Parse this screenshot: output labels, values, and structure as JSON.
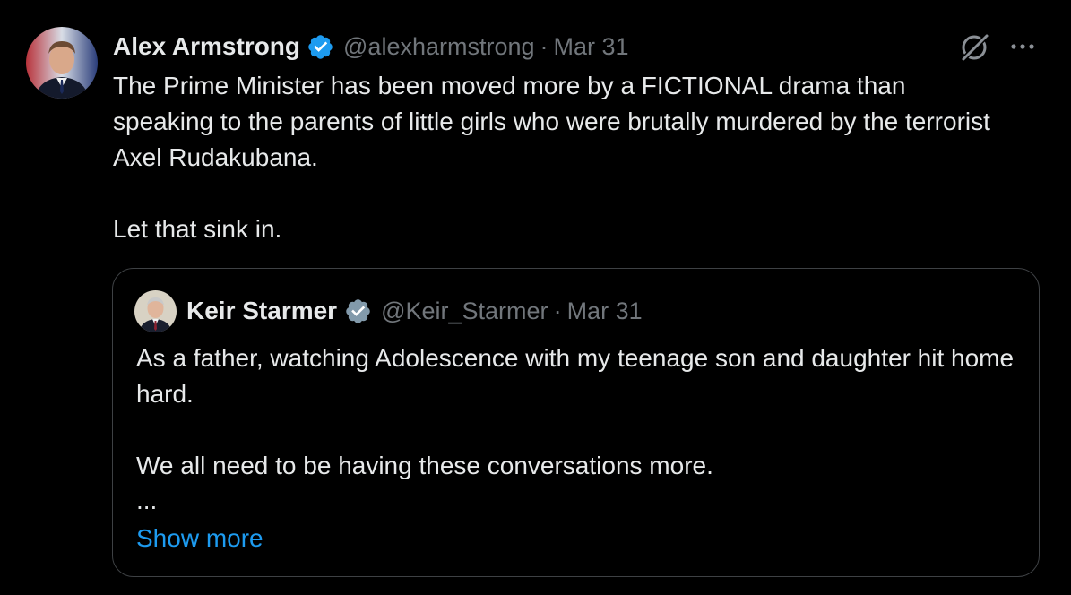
{
  "tweet": {
    "author_name": "Alex Armstrong",
    "handle": "@alexharmstrong",
    "separator": "·",
    "date": "Mar 31",
    "text_lines": [
      "The Prime Minister has been moved more by a FICTIONAL drama than speaking to the parents of little girls who were brutally murdered by the terrorist Axel Rudakubana.",
      "Let that sink in."
    ],
    "avatar_icon": "avatar-photo",
    "verified_icon": "verified-badge-blue",
    "verified_color": "#1d9bf0",
    "grok_icon": "grok-icon",
    "more_icon": "more-horizontal-icon"
  },
  "quote": {
    "author_name": "Keir Starmer",
    "handle": "@Keir_Starmer",
    "separator": "·",
    "date": "Mar 31",
    "text_lines": [
      "As a father, watching Adolescence with my teenage son and daughter hit home hard.",
      "We all need to be having these conversations more.",
      "..."
    ],
    "show_more": "Show more",
    "verified_icon": "verified-badge-gray",
    "verified_color": "#829aab"
  },
  "colors": {
    "background": "#000000",
    "text_primary": "#e7e9ea",
    "text_secondary": "#71767b",
    "link": "#1d9bf0",
    "border": "#3e4144"
  }
}
